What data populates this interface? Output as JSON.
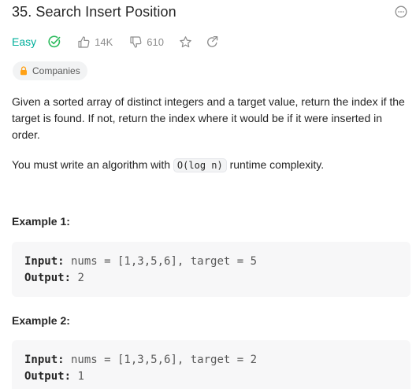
{
  "problem": {
    "title": "35. Search Insert Position",
    "difficulty": "Easy",
    "likes": "14K",
    "dislikes": "610",
    "companies_label": "Companies"
  },
  "description": {
    "paragraph": "Given a sorted array of distinct integers and a target value, return the index if the target is found. If not, return the index where it would be if it were inserted in order.",
    "complexity_before": "You must write an algorithm with ",
    "complexity_code": "O(log n)",
    "complexity_after": " runtime complexity."
  },
  "examples": [
    {
      "title": "Example 1:",
      "input_label": "Input:",
      "input_value": " nums = [1,3,5,6], target = 5",
      "output_label": "Output:",
      "output_value": " 2"
    },
    {
      "title": "Example 2:",
      "input_label": "Input:",
      "input_value": " nums = [1,3,5,6], target = 2",
      "output_label": "Output:",
      "output_value": " 1"
    }
  ],
  "icons": {
    "more": "more-options-icon",
    "solved": "solved-check-icon",
    "like": "thumbs-up-icon",
    "dislike": "thumbs-down-icon",
    "favorite": "star-icon",
    "share": "share-icon",
    "lock": "lock-icon"
  },
  "colors": {
    "easy": "#00af9b",
    "lock": "#ffa116",
    "muted": "#8c8c8c"
  }
}
